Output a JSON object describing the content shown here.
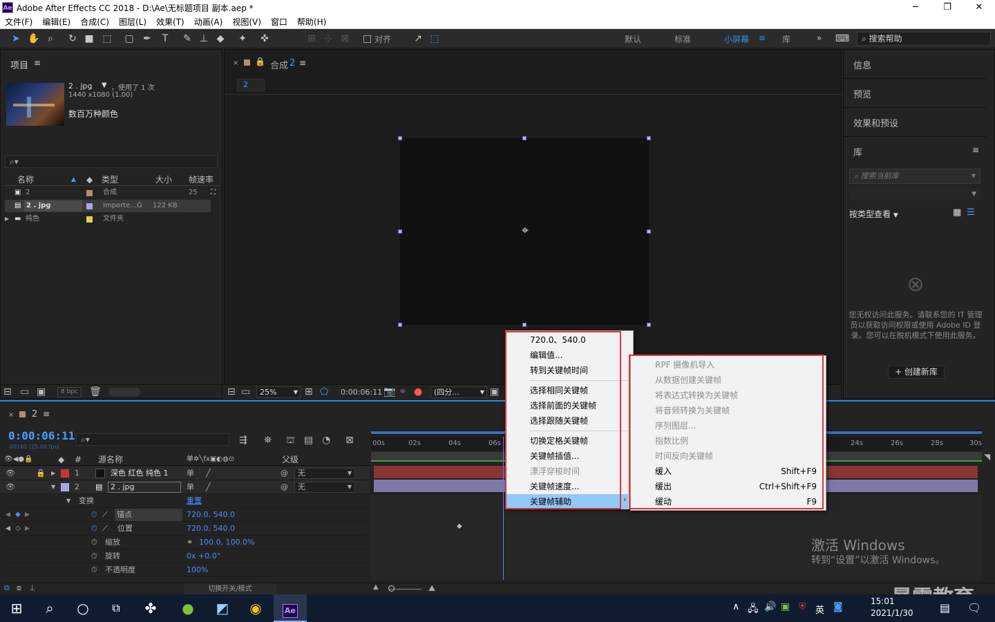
{
  "window": {
    "title": "Adobe After Effects CC 2018 - D:\\Ae\\无标题项目 副本.aep *",
    "logo": "Ae",
    "controls": [
      "─",
      "❐",
      "✕"
    ]
  },
  "menubar": [
    "文件(F)",
    "编辑(E)",
    "合成(C)",
    "图层(L)",
    "效果(T)",
    "动画(A)",
    "视图(V)",
    "窗口",
    "帮助(H)"
  ],
  "toolbar": {
    "align_label": "对齐",
    "workspaces": [
      "默认",
      "标准",
      "小屏幕",
      "库"
    ],
    "active_workspace": "小屏幕",
    "search_placeholder": "搜索帮助",
    "accent": "#2d8ceb"
  },
  "project": {
    "header": "项目",
    "item_name": "2 . jpg",
    "item_used": "，使用了 1 次",
    "item_dims": "1440 x1080 (1.00)",
    "item_colors": "数百万种颜色",
    "columns": [
      "名称",
      "类型",
      "大小",
      "帧速率"
    ],
    "rows": [
      {
        "name": "2",
        "type": "合成",
        "size": "",
        "fps": "25",
        "color": "#b38c73"
      },
      {
        "name": "2 . jpg",
        "type": "Importe...G",
        "size": "122 KB",
        "fps": "",
        "color": "#a8a8e0"
      },
      {
        "name": "纯色",
        "type": "文件夹",
        "size": "",
        "fps": "",
        "color": "#e6d04a"
      }
    ],
    "bpc": "8 bpc"
  },
  "composition": {
    "header": "合成",
    "name": "2",
    "tab": "2",
    "zoom": "25%",
    "timecode": "0:00:06:11",
    "view": "(四分..."
  },
  "right_panel": {
    "sections": [
      "信息",
      "预览",
      "效果和预设",
      "库"
    ],
    "library_search": "搜索当前库",
    "view_by": "按类型查看",
    "no_access_message": "您无权访问此服务。请联系您的 IT 管理员以获取访问权限或使用 Adobe ID 登录。您可以在脱机模式下使用此服务。",
    "create_library": "+ 创建新库"
  },
  "timeline": {
    "comp_name": "2",
    "timecode": "0:00:06:11",
    "frame_info": "00161 (25.00 fps)",
    "col_source": "源名称",
    "col_parent": "父级",
    "ruler": [
      "00s",
      "02s",
      "04s",
      "06s",
      "24s",
      "26s",
      "28s",
      "30s"
    ],
    "layers": [
      {
        "num": "1",
        "name": "深色 红色 纯色 1",
        "parent": "无",
        "color": "#c23838"
      },
      {
        "num": "2",
        "name": "2 . jpg",
        "parent": "无",
        "color": "#a8a8e0"
      }
    ],
    "transform_label": "变换",
    "reset_label": "重置",
    "properties": [
      {
        "name": "锚点",
        "value": "720.0, 540.0"
      },
      {
        "name": "位置",
        "value": "720.0, 540.0"
      },
      {
        "name": "缩放",
        "value": "100.0, 100.0%"
      },
      {
        "name": "旋转",
        "value": "0x +0.0°"
      },
      {
        "name": "不透明度",
        "value": "100%"
      }
    ],
    "toggle_modes": "切换开关/模式"
  },
  "context_menu": {
    "items": [
      {
        "label": "720.0、540.0",
        "disabled": false
      },
      {
        "label": "编辑值...",
        "disabled": false
      },
      {
        "label": "转到关键帧时间",
        "disabled": false
      },
      {
        "label": "选择相同关键帧",
        "disabled": false
      },
      {
        "label": "选择前面的关键帧",
        "disabled": false
      },
      {
        "label": "选择跟随关键帧",
        "disabled": false
      },
      {
        "label": "切换定格关键帧",
        "disabled": false
      },
      {
        "label": "关键帧插值...",
        "disabled": false
      },
      {
        "label": "漂浮穿梭时间",
        "disabled": true
      },
      {
        "label": "关键帧速度...",
        "disabled": false
      },
      {
        "label": "关键帧辅助",
        "disabled": false
      }
    ]
  },
  "submenu": {
    "items": [
      {
        "label": "RPF 摄像机导入",
        "shortcut": "",
        "disabled": true
      },
      {
        "label": "从数据创建关键帧",
        "shortcut": "",
        "disabled": true
      },
      {
        "label": "将表达式转换为关键帧",
        "shortcut": "",
        "disabled": true
      },
      {
        "label": "将音频转换为关键帧",
        "shortcut": "",
        "disabled": true
      },
      {
        "label": "序列图层...",
        "shortcut": "",
        "disabled": true
      },
      {
        "label": "指数比例",
        "shortcut": "",
        "disabled": true
      },
      {
        "label": "时间反向关键帧",
        "shortcut": "",
        "disabled": true
      },
      {
        "label": "缓入",
        "shortcut": "Shift+F9",
        "disabled": false
      },
      {
        "label": "缓出",
        "shortcut": "Ctrl+Shift+F9",
        "disabled": false
      },
      {
        "label": "缓动",
        "shortcut": "F9",
        "disabled": false
      }
    ]
  },
  "watermark": {
    "line1": "激活 Windows",
    "line2": "转到“设置”以激活 Windows。",
    "brand": "暴需教育"
  },
  "taskbar": {
    "time": "15:01",
    "date": "2021/1/30",
    "lang": "英",
    "ae": "Ae"
  }
}
